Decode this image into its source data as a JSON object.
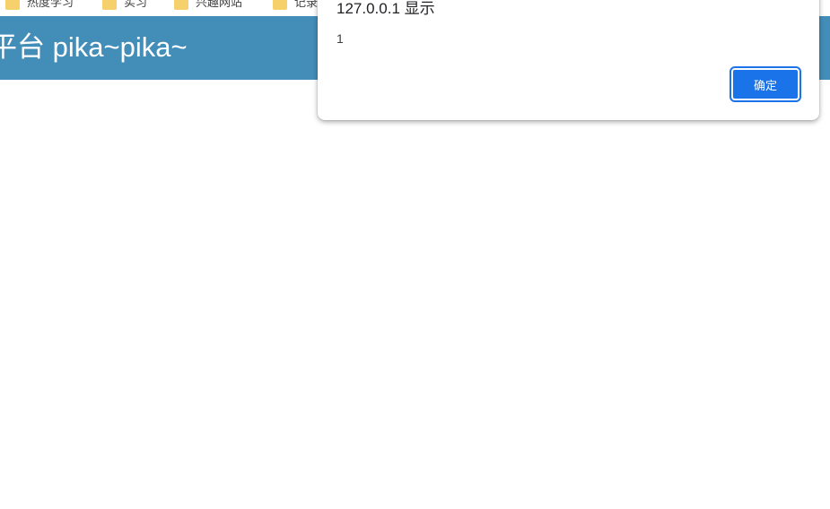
{
  "bookmarks": [
    {
      "label": "热度学习",
      "icon": "folder-icon"
    },
    {
      "label": "实习",
      "icon": "folder-icon"
    },
    {
      "label": "兴趣网站",
      "icon": "folder-icon"
    },
    {
      "label": "记录",
      "icon": "folder-icon"
    }
  ],
  "header": {
    "title": "平台 pika~pika~",
    "background": "#438eb9"
  },
  "alert": {
    "title": "127.0.0.1 显示",
    "message": "1",
    "ok_label": "确定",
    "accent": "#1a73e8"
  }
}
